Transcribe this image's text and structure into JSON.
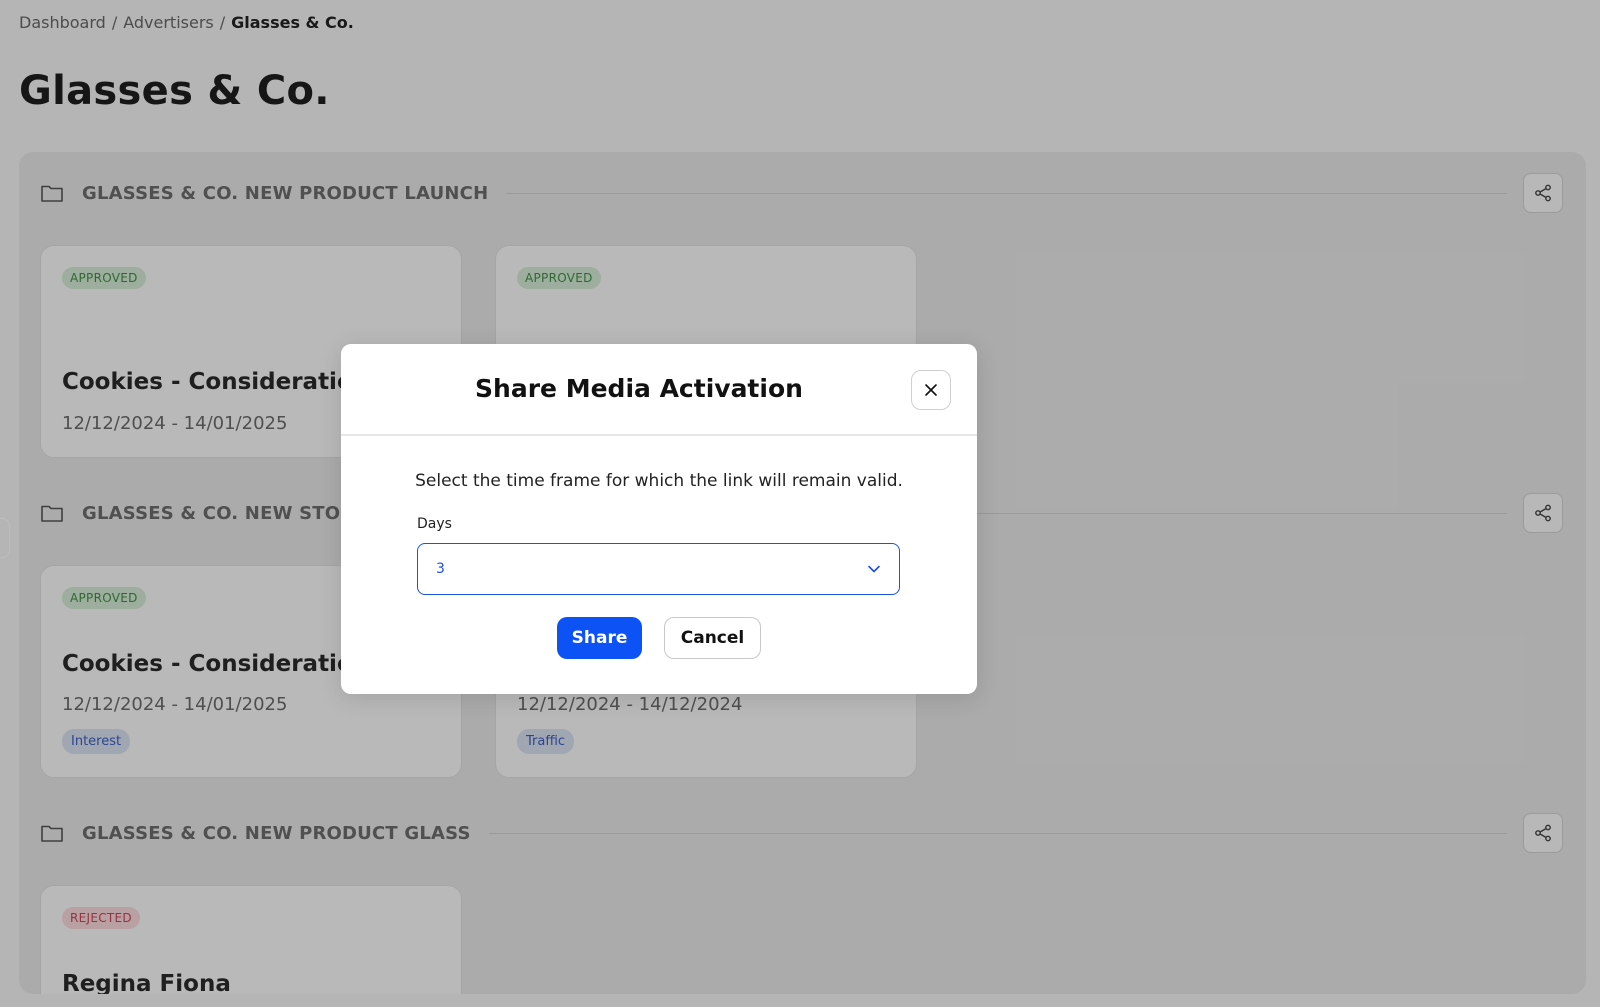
{
  "breadcrumb": {
    "items": [
      "Dashboard",
      "Advertisers"
    ],
    "current": "Glasses & Co.",
    "separator": "/"
  },
  "page_title": "Glasses & Co.",
  "groups": [
    {
      "title": "GLASSES & CO. NEW PRODUCT LAUNCH",
      "cards": [
        {
          "status": "APPROVED",
          "title": "Cookies - Consideration",
          "dates": "12/12/2024 - 14/01/2025",
          "tag": ""
        },
        {
          "status": "APPROVED",
          "title": "",
          "dates": "",
          "tag": ""
        }
      ]
    },
    {
      "title": "GLASSES & CO. NEW STORE C",
      "cards": [
        {
          "status": "APPROVED",
          "title": "Cookies - Consideration",
          "dates": "12/12/2024 - 14/01/2025",
          "tag": "Interest"
        },
        {
          "status": "",
          "title": "",
          "dates": "12/12/2024 - 14/12/2024",
          "tag": "Traffic"
        }
      ]
    },
    {
      "title": "GLASSES & CO. NEW PRODUCT GLASS",
      "cards": [
        {
          "status": "REJECTED",
          "title": "Regina Fiona",
          "dates": "",
          "tag": ""
        }
      ]
    }
  ],
  "modal": {
    "title": "Share Media Activation",
    "description": "Select the time frame for which the link will remain valid.",
    "field_label": "Days",
    "select_value": "3",
    "share_label": "Share",
    "cancel_label": "Cancel"
  },
  "colors": {
    "primary": "#0d52f5",
    "approved_badge": "#3f8a45",
    "rejected_badge": "#c9445a",
    "tag": "#3c5dba"
  },
  "icons": {
    "folder": "folder-icon",
    "share": "share-icon",
    "close": "close-icon",
    "chevron": "chevron-down-icon"
  }
}
